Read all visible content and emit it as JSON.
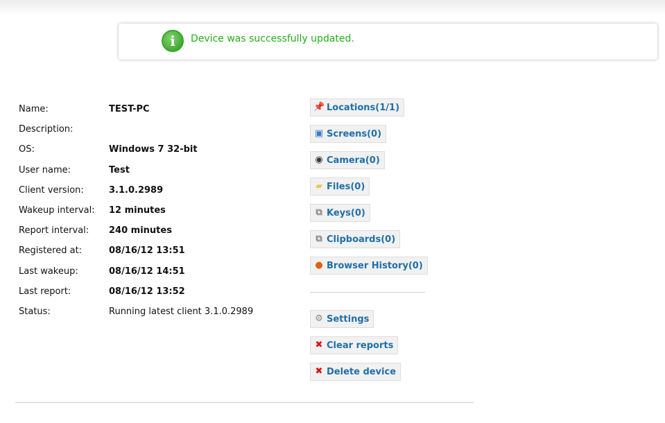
{
  "notice": {
    "message": "Device was successfully updated.",
    "icon": "info-icon",
    "color": "#22b014"
  },
  "details": [
    {
      "label": "Name:",
      "value": "TEST-PC",
      "bold": true
    },
    {
      "label": "Description:",
      "value": "",
      "bold": true
    },
    {
      "label": "OS:",
      "value": "Windows 7 32-bit",
      "bold": true
    },
    {
      "label": "User name:",
      "value": "Test",
      "bold": true
    },
    {
      "label": "Client version:",
      "value": "3.1.0.2989",
      "bold": true
    },
    {
      "label": "Wakeup interval:",
      "value": "12 minutes",
      "bold": true
    },
    {
      "label": "Report interval:",
      "value": "240 minutes",
      "bold": true
    },
    {
      "label": "Registered at:",
      "value": "08/16/12 13:51",
      "bold": true
    },
    {
      "label": "Last wakeup:",
      "value": "08/16/12 14:51",
      "bold": true
    },
    {
      "label": "Last report:",
      "value": "08/16/12 13:52",
      "bold": true
    },
    {
      "label": "Status:",
      "value": "Running latest client 3.1.0.2989",
      "bold": false
    }
  ],
  "actions": [
    {
      "label": "Locations(1/1)",
      "icon": "pushpin-icon"
    },
    {
      "label": "Screens(0)",
      "icon": "picture-icon"
    },
    {
      "label": "Camera(0)",
      "icon": "webcam-icon"
    },
    {
      "label": "Files(0)",
      "icon": "folder-icon"
    },
    {
      "label": "Keys(0)",
      "icon": "copy-icon"
    },
    {
      "label": "Clipboards(0)",
      "icon": "copy-icon"
    },
    {
      "label": "Browser History(0)",
      "icon": "firefox-icon"
    }
  ],
  "manage": [
    {
      "label": "Settings",
      "icon": "gear-icon"
    },
    {
      "label": "Clear reports",
      "icon": "red-x-icon"
    },
    {
      "label": "Delete device",
      "icon": "red-x-icon"
    }
  ]
}
